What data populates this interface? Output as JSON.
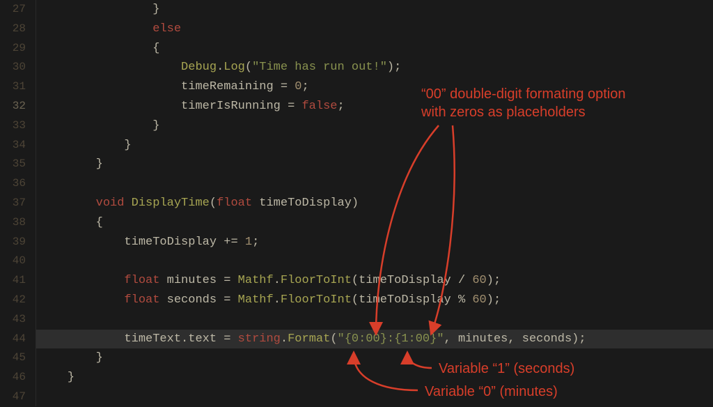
{
  "gutter": {
    "start": 27,
    "end": 47,
    "highlighted": 32
  },
  "code": {
    "l27": {
      "indent": "                ",
      "brace": "}"
    },
    "l28": {
      "indent": "                ",
      "kw": "else"
    },
    "l29": {
      "indent": "                ",
      "brace": "{"
    },
    "l30": {
      "indent": "                    ",
      "cls": "Debug",
      "dot": ".",
      "fn": "Log",
      "open": "(",
      "str": "\"Time has run out!\"",
      "close": ");"
    },
    "l31": {
      "indent": "                    ",
      "id": "timeRemaining",
      "op": " = ",
      "num": "0",
      "semi": ";"
    },
    "l32": {
      "indent": "                    ",
      "id": "timerIsRunning",
      "op": " = ",
      "kw": "false",
      "semi": ";"
    },
    "l33": {
      "indent": "                ",
      "brace": "}"
    },
    "l34": {
      "indent": "            ",
      "brace": "}"
    },
    "l35": {
      "indent": "        ",
      "brace": "}"
    },
    "l36": {
      "indent": ""
    },
    "l37": {
      "indent": "        ",
      "kw": "void",
      "sp": " ",
      "fn": "DisplayTime",
      "open": "(",
      "ty": "float",
      "sp2": " ",
      "arg": "timeToDisplay",
      "close": ")"
    },
    "l38": {
      "indent": "        ",
      "brace": "{"
    },
    "l39": {
      "indent": "            ",
      "id": "timeToDisplay",
      "op": " += ",
      "num": "1",
      "semi": ";"
    },
    "l40": {
      "indent": ""
    },
    "l41": {
      "indent": "            ",
      "ty": "float",
      "sp": " ",
      "id": "minutes",
      "op": " = ",
      "cls": "Mathf",
      "dot": ".",
      "fn": "FloorToInt",
      "open": "(",
      "arg": "timeToDisplay / ",
      "num": "60",
      "close": ");"
    },
    "l42": {
      "indent": "            ",
      "ty": "float",
      "sp": " ",
      "id": "seconds",
      "op": " = ",
      "cls": "Mathf",
      "dot": ".",
      "fn": "FloorToInt",
      "open": "(",
      "arg": "timeToDisplay % ",
      "num": "60",
      "close": ");"
    },
    "l43": {
      "indent": ""
    },
    "l44": {
      "indent": "            ",
      "obj": "timeText",
      "dot1": ".",
      "prop": "text",
      "op": " = ",
      "kw": "string",
      "dot2": ".",
      "fn": "Format",
      "open": "(",
      "str": "\"{0:00}:{1:00}\"",
      "args": ", minutes, seconds);",
      "close": ""
    },
    "l45": {
      "indent": "        ",
      "brace": "}"
    },
    "l46": {
      "indent": "    ",
      "brace": "}"
    }
  },
  "annotations": {
    "a1": "“00” double-digit formating option\nwith zeros as placeholders",
    "a2": "Variable “1” (seconds)",
    "a3": "Variable “0” (minutes)"
  },
  "colors": {
    "annotation": "#d83e2a",
    "bg": "#1a1a1a"
  }
}
